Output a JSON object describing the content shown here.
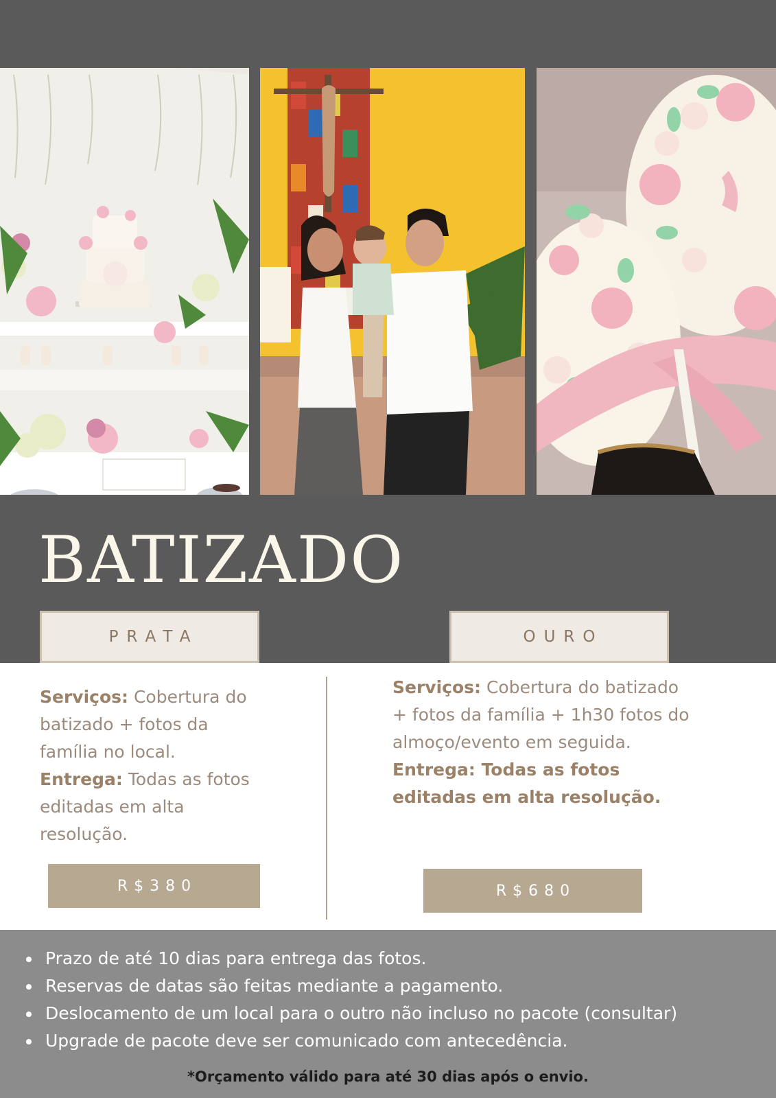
{
  "title": "BATIZADO",
  "packages": [
    {
      "label": "PRATA",
      "services_label": "Serviços:",
      "services_text": " Cobertura do batizado + fotos da família no local.",
      "delivery_label": "Entrega:",
      "delivery_text": " Todas as fotos editadas em alta resolução.",
      "price": "R$380"
    },
    {
      "label": "OURO",
      "services_label": "Serviços:",
      "services_text": " Cobertura do batizado + fotos da família + 1h30 fotos do almoço/evento em seguida.",
      "delivery_label": "Entrega: Todas as fotos editadas em alta resolução.",
      "delivery_text": "",
      "price": "R$680"
    }
  ],
  "notes": [
    "Prazo de até 10 dias para entrega das fotos.",
    "Reservas de datas são feitas mediante a pagamento.",
    "Deslocamento de um local para o outro não incluso no pacote (consultar)",
    "Upgrade de pacote deve ser comunicado com antecedência."
  ],
  "footnote": "*Orçamento válido para até 30 dias após o envio.",
  "colors": {
    "dark_band": "#5a5a5a",
    "beige_accent": "#b7a892",
    "text_brown": "#9a8167",
    "bottom_band": "#8c8c8c"
  }
}
